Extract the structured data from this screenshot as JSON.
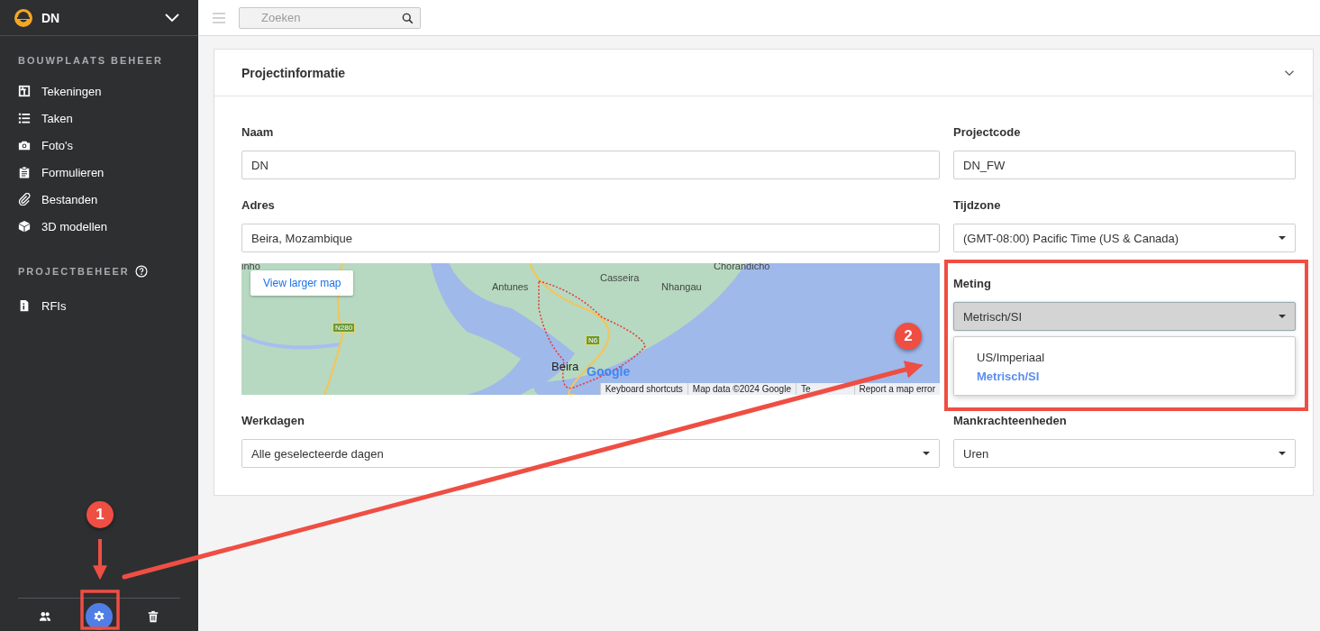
{
  "sidebar": {
    "project": {
      "name": "DN"
    },
    "sections": [
      {
        "title": "BOUWPLAATS BEHEER",
        "help": false,
        "items": [
          {
            "label": "Tekeningen",
            "kind": "drawings"
          },
          {
            "label": "Taken",
            "kind": "tasks"
          },
          {
            "label": "Foto's",
            "kind": "photos"
          },
          {
            "label": "Formulieren",
            "kind": "forms"
          },
          {
            "label": "Bestanden",
            "kind": "files"
          },
          {
            "label": "3D modellen",
            "kind": "models"
          }
        ]
      },
      {
        "title": "PROJECTBEHEER",
        "help": true,
        "items": [
          {
            "label": "RFIs",
            "kind": "rfi"
          }
        ]
      }
    ],
    "footer_buttons": [
      {
        "kind": "people",
        "selected": false
      },
      {
        "kind": "settings",
        "selected": true
      },
      {
        "kind": "trash",
        "selected": false
      }
    ]
  },
  "search": {
    "placeholder": "Zoeken"
  },
  "panel": {
    "title": "Projectinformatie",
    "expanded": true,
    "rows": [
      {
        "left": {
          "kind": "text",
          "label": "Naam",
          "value": "DN"
        },
        "right": {
          "kind": "text",
          "label": "Projectcode",
          "value": "DN_FW"
        }
      },
      {
        "left": {
          "kind": "text",
          "label": "Adres",
          "value": "Beira, Mozambique"
        },
        "right": {
          "kind": "select",
          "label": "Tijdzone",
          "value": "(GMT-08:00) Pacific Time (US & Canada)",
          "open": false
        }
      },
      {
        "left": {
          "kind": "map",
          "button": "View larger map",
          "places": [
            "inho",
            "Chorandicho",
            "Antunes",
            "Casseira",
            "Nhangau",
            "Beira"
          ],
          "roads": [
            "N280",
            "N6"
          ],
          "logo": "Google",
          "footer": [
            "Keyboard shortcuts",
            "Map data ©2024 Google",
            "Te",
            "Report a map error"
          ]
        },
        "right": {
          "kind": "select",
          "label": "Meting",
          "value": "Metrisch/SI",
          "open": true,
          "options": [
            {
              "label": "US/Imperiaal",
              "selected": false
            },
            {
              "label": "Metrisch/SI",
              "selected": true
            }
          ]
        }
      },
      {
        "left": {
          "kind": "select",
          "label": "Werkdagen",
          "value": "Alle geselecteerde dagen",
          "open": false
        },
        "right": {
          "kind": "select",
          "label": "Mankrachteenheden",
          "value": "Uren",
          "open": false
        }
      }
    ]
  },
  "annotations": [
    {
      "number": "1"
    },
    {
      "number": "2"
    }
  ]
}
